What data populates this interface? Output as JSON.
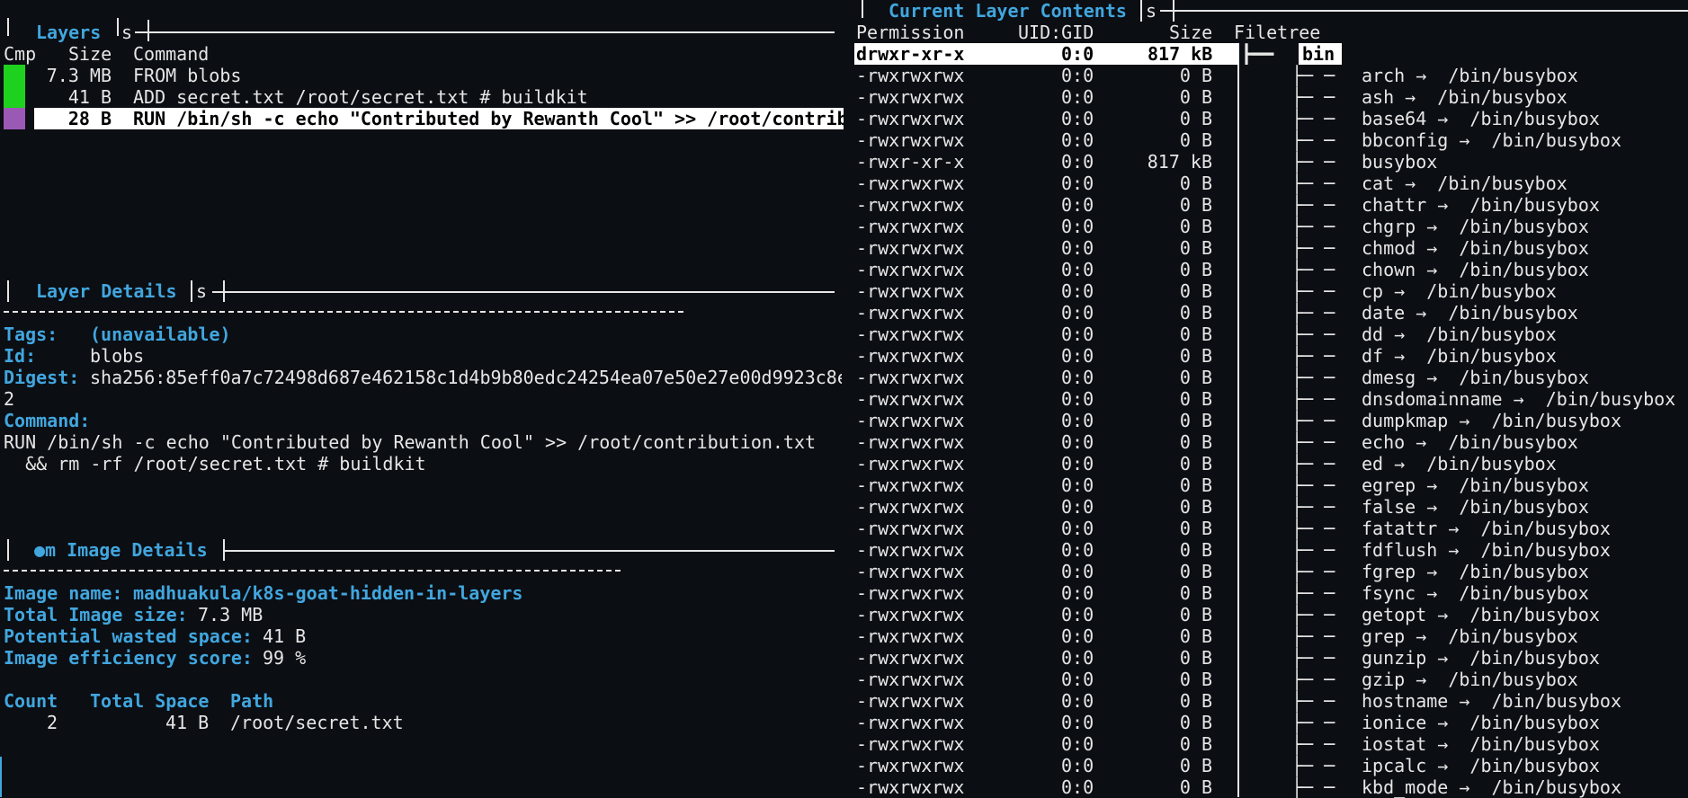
{
  "colors": {
    "blue": "#41a6de",
    "green": "#1fd11f",
    "purple": "#9b59b6",
    "bg": "#0b0e13"
  },
  "layers": {
    "title": "Layers",
    "filter_hint": "s",
    "headers": {
      "cmp": "Cmp",
      "size": "Size",
      "command": "Command"
    },
    "rows": [
      {
        "size": "7.3 MB",
        "command": "FROM blobs",
        "color": "green"
      },
      {
        "size": "41 B",
        "command": "ADD secret.txt /root/secret.txt # buildkit",
        "color": "green"
      },
      {
        "size": "28 B",
        "command": "RUN /bin/sh -c echo \"Contributed by Rewanth Cool\" >> /root/contrib",
        "color": "purple",
        "selected": true
      }
    ]
  },
  "layer_details": {
    "title": "Layer Details",
    "filter_hint": "s",
    "tags_label": "Tags:",
    "tags_value": "(unavailable)",
    "id_label": "Id:",
    "id_value": "blobs",
    "digest_label": "Digest:",
    "digest_value": "sha256:85eff0a7c72498d687e462158c1d4b9b80edc24254ea07e50e27e00d9923c8e",
    "digest_wrap": "2",
    "command_label": "Command:",
    "command_line1": "RUN /bin/sh -c echo \"Contributed by Rewanth Cool\" >> /root/contribution.txt",
    "command_line2": "  && rm -rf /root/secret.txt # buildkit"
  },
  "image_details": {
    "title": "●m Image Details",
    "name_label": "Image name:",
    "name_value": "madhuakula/k8s-goat-hidden-in-layers",
    "size_label": "Total Image size:",
    "size_value": "7.3 MB",
    "wasted_label": "Potential wasted space:",
    "wasted_value": "41 B",
    "efficiency_label": "Image efficiency score:",
    "efficiency_value": "99 %",
    "table_headers": {
      "count": "Count",
      "total_space": "Total Space",
      "path": "Path"
    },
    "rows": [
      {
        "count": "2",
        "total_space": "41 B",
        "path": "/root/secret.txt"
      }
    ]
  },
  "contents": {
    "title": "Current Layer Contents",
    "filter_hint": "s",
    "headers": {
      "permission": "Permission",
      "uidgid": "UID:GID",
      "size": "Size",
      "filetree": "Filetree"
    },
    "dir": {
      "permission": "drwxr-xr-x",
      "uidgid": "0:0",
      "size": "817 kB",
      "name": "bin"
    },
    "files": [
      {
        "p": "-rwxrwxrwx",
        "u": "0:0",
        "s": "0 B",
        "n": "arch →  /bin/busybox"
      },
      {
        "p": "-rwxrwxrwx",
        "u": "0:0",
        "s": "0 B",
        "n": "ash →  /bin/busybox"
      },
      {
        "p": "-rwxrwxrwx",
        "u": "0:0",
        "s": "0 B",
        "n": "base64 →  /bin/busybox"
      },
      {
        "p": "-rwxrwxrwx",
        "u": "0:0",
        "s": "0 B",
        "n": "bbconfig →  /bin/busybox"
      },
      {
        "p": "-rwxr-xr-x",
        "u": "0:0",
        "s": "817 kB",
        "n": "busybox"
      },
      {
        "p": "-rwxrwxrwx",
        "u": "0:0",
        "s": "0 B",
        "n": "cat →  /bin/busybox"
      },
      {
        "p": "-rwxrwxrwx",
        "u": "0:0",
        "s": "0 B",
        "n": "chattr →  /bin/busybox"
      },
      {
        "p": "-rwxrwxrwx",
        "u": "0:0",
        "s": "0 B",
        "n": "chgrp →  /bin/busybox"
      },
      {
        "p": "-rwxrwxrwx",
        "u": "0:0",
        "s": "0 B",
        "n": "chmod →  /bin/busybox"
      },
      {
        "p": "-rwxrwxrwx",
        "u": "0:0",
        "s": "0 B",
        "n": "chown →  /bin/busybox"
      },
      {
        "p": "-rwxrwxrwx",
        "u": "0:0",
        "s": "0 B",
        "n": "cp →  /bin/busybox"
      },
      {
        "p": "-rwxrwxrwx",
        "u": "0:0",
        "s": "0 B",
        "n": "date →  /bin/busybox"
      },
      {
        "p": "-rwxrwxrwx",
        "u": "0:0",
        "s": "0 B",
        "n": "dd →  /bin/busybox"
      },
      {
        "p": "-rwxrwxrwx",
        "u": "0:0",
        "s": "0 B",
        "n": "df →  /bin/busybox"
      },
      {
        "p": "-rwxrwxrwx",
        "u": "0:0",
        "s": "0 B",
        "n": "dmesg →  /bin/busybox"
      },
      {
        "p": "-rwxrwxrwx",
        "u": "0:0",
        "s": "0 B",
        "n": "dnsdomainname →  /bin/busybox"
      },
      {
        "p": "-rwxrwxrwx",
        "u": "0:0",
        "s": "0 B",
        "n": "dumpkmap →  /bin/busybox"
      },
      {
        "p": "-rwxrwxrwx",
        "u": "0:0",
        "s": "0 B",
        "n": "echo →  /bin/busybox"
      },
      {
        "p": "-rwxrwxrwx",
        "u": "0:0",
        "s": "0 B",
        "n": "ed →  /bin/busybox"
      },
      {
        "p": "-rwxrwxrwx",
        "u": "0:0",
        "s": "0 B",
        "n": "egrep →  /bin/busybox"
      },
      {
        "p": "-rwxrwxrwx",
        "u": "0:0",
        "s": "0 B",
        "n": "false →  /bin/busybox"
      },
      {
        "p": "-rwxrwxrwx",
        "u": "0:0",
        "s": "0 B",
        "n": "fatattr →  /bin/busybox"
      },
      {
        "p": "-rwxrwxrwx",
        "u": "0:0",
        "s": "0 B",
        "n": "fdflush →  /bin/busybox"
      },
      {
        "p": "-rwxrwxrwx",
        "u": "0:0",
        "s": "0 B",
        "n": "fgrep →  /bin/busybox"
      },
      {
        "p": "-rwxrwxrwx",
        "u": "0:0",
        "s": "0 B",
        "n": "fsync →  /bin/busybox"
      },
      {
        "p": "-rwxrwxrwx",
        "u": "0:0",
        "s": "0 B",
        "n": "getopt →  /bin/busybox"
      },
      {
        "p": "-rwxrwxrwx",
        "u": "0:0",
        "s": "0 B",
        "n": "grep →  /bin/busybox"
      },
      {
        "p": "-rwxrwxrwx",
        "u": "0:0",
        "s": "0 B",
        "n": "gunzip →  /bin/busybox"
      },
      {
        "p": "-rwxrwxrwx",
        "u": "0:0",
        "s": "0 B",
        "n": "gzip →  /bin/busybox"
      },
      {
        "p": "-rwxrwxrwx",
        "u": "0:0",
        "s": "0 B",
        "n": "hostname →  /bin/busybox"
      },
      {
        "p": "-rwxrwxrwx",
        "u": "0:0",
        "s": "0 B",
        "n": "ionice →  /bin/busybox"
      },
      {
        "p": "-rwxrwxrwx",
        "u": "0:0",
        "s": "0 B",
        "n": "iostat →  /bin/busybox"
      },
      {
        "p": "-rwxrwxrwx",
        "u": "0:0",
        "s": "0 B",
        "n": "ipcalc →  /bin/busybox"
      },
      {
        "p": "-rwxrwxrwx",
        "u": "0:0",
        "s": "0 B",
        "n": "kbd_mode →  /bin/busybox"
      }
    ]
  }
}
